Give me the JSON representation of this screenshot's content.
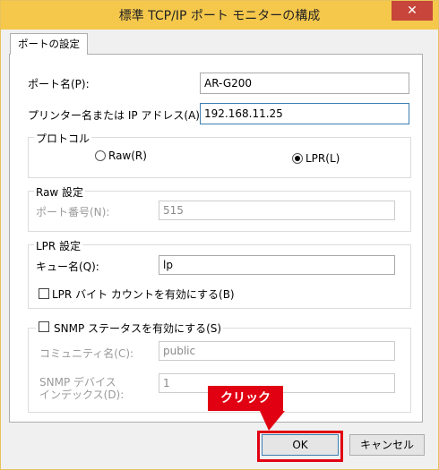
{
  "window": {
    "title": "標準 TCP/IP ポート モニターの構成",
    "close_symbol": "✕"
  },
  "tab": {
    "label": "ポートの設定"
  },
  "fields": {
    "port_name_label": "ポート名(P):",
    "port_name_value": "AR-G200",
    "printer_label": "プリンター名または IP アドレス(A):",
    "printer_value": "192.168.11.25"
  },
  "protocol": {
    "label": "プロトコル",
    "raw": "Raw(R)",
    "lpr": "LPR(L)",
    "selected": "LPR"
  },
  "raw_settings": {
    "label": "Raw 設定",
    "port_number_label": "ポート番号(N):",
    "port_number_value": "515"
  },
  "lpr_settings": {
    "label": "LPR 設定",
    "queue_label": "キュー名(Q):",
    "queue_value": "lp",
    "byte_count_label": "LPR バイト カウントを有効にする(B)"
  },
  "snmp": {
    "enable_label": "SNMP ステータスを有効にする(S)",
    "community_label": "コミュニティ名(C):",
    "community_value": "public",
    "device_index_label_line1": "SNMP デバイス",
    "device_index_label_line2": "インデックス(D):",
    "device_index_value": "1"
  },
  "buttons": {
    "ok": "OK",
    "cancel": "キャンセル"
  },
  "annotation": {
    "click": "クリック"
  },
  "colors": {
    "titlebar": "#f5c84c",
    "highlight": "#e00012"
  }
}
